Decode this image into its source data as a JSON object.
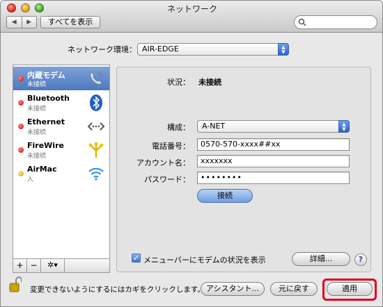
{
  "window": {
    "title": "ネットワーク"
  },
  "toolbar": {
    "back": "◀",
    "forward": "▶",
    "show_all": "すべてを表示",
    "search_placeholder": ""
  },
  "location": {
    "label": "ネットワーク環境：",
    "value": "AIR-EDGE"
  },
  "services": [
    {
      "name": "内蔵モデム",
      "status": "未接続",
      "dot": "#c80000",
      "icon": "phone-modem-icon",
      "selected": true
    },
    {
      "name": "Bluetooth",
      "status": "未接続",
      "dot": "#c80000",
      "icon": "bluetooth-icon"
    },
    {
      "name": "Ethernet",
      "status": "未接続",
      "dot": "#c80000",
      "icon": "ethernet-icon"
    },
    {
      "name": "FireWire",
      "status": "未接続",
      "dot": "#c80000",
      "icon": "firewire-icon"
    },
    {
      "name": "AirMac",
      "status": "入",
      "dot": "#d9a000",
      "icon": "wifi-icon"
    }
  ],
  "sidebar_controls": {
    "add": "+",
    "remove": "−",
    "gear": "✲▾"
  },
  "detail": {
    "status_label": "状況：",
    "status_value": "未接続",
    "config_label": "構成：",
    "config_value": "A-NET",
    "phone_label": "電話番号：",
    "phone_value": "0570-570-xxxx##xx",
    "account_label": "アカウント名：",
    "account_value": "xxxxxxx",
    "password_label": "パスワード：",
    "password_value": "••••••••",
    "connect_button": "接続",
    "menu_checkbox_label": "メニューバーにモデムの状況を表示",
    "details_button": "詳細...",
    "help": "?"
  },
  "bottom": {
    "lock_text": "変更できないようにするにはカギをクリックします。",
    "assistant_button": "アシスタント...",
    "revert_button": "元に戻す",
    "apply_button": "適用"
  },
  "colors": {
    "highlight": "#e0001a",
    "selection": "#5a82c4"
  }
}
